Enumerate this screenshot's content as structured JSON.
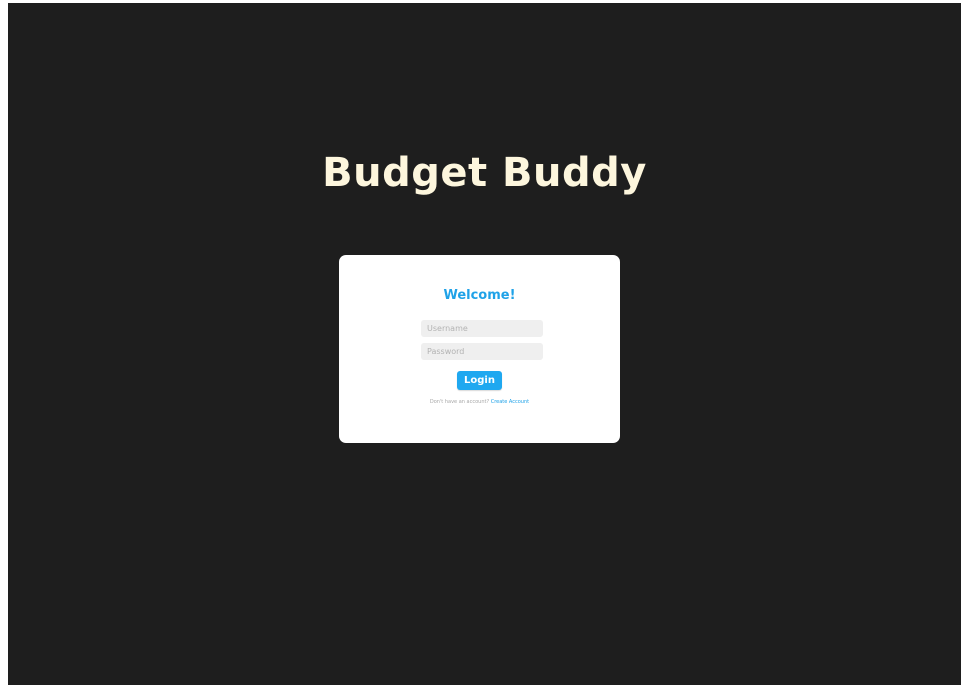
{
  "app": {
    "title": "Budget Buddy"
  },
  "login_card": {
    "heading": "Welcome!",
    "username_placeholder": "Username",
    "username_value": "",
    "password_placeholder": "Password",
    "password_value": "",
    "login_label": "Login",
    "signup_prompt": "Don't have an account?",
    "create_account_label": "Create Account"
  },
  "colors": {
    "background": "#1e1e1e",
    "title": "#fdf6dd",
    "accent": "#1fa2e8",
    "card": "#ffffff",
    "field": "#efefef"
  }
}
